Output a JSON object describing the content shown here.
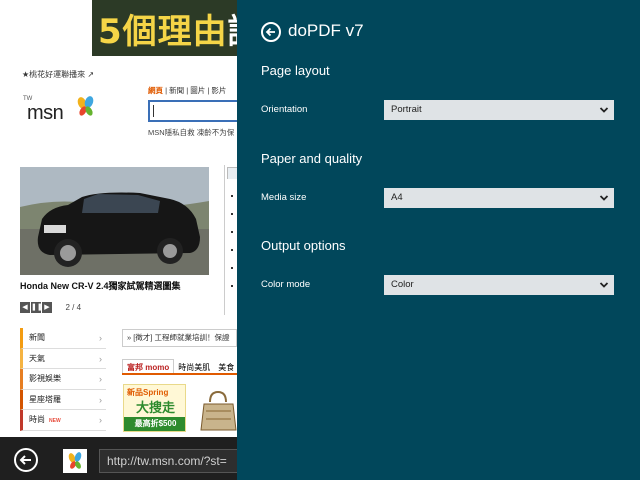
{
  "browser": {
    "ad_banner_text": "5個理由",
    "ad_banner_last_char": "讓",
    "favorites_link": "★桃花好運聯播來 ↗",
    "msn_tw": "TW",
    "msn_word": "msn",
    "search_tabs": [
      {
        "label": "網頁"
      },
      {
        "label": "新聞"
      },
      {
        "label": "圖片"
      },
      {
        "label": "影片"
      }
    ],
    "search_hint": "MSN隱私自救  凍齡不为保",
    "car_caption": "Honda New CR-V 2.4獨家試駕精選圖集",
    "slide_counter": "2 / 4",
    "categories": [
      {
        "label": "新聞"
      },
      {
        "label": "天氣"
      },
      {
        "label": "影視娛樂"
      },
      {
        "label": "星座塔羅"
      },
      {
        "label": "時尚",
        "badge": "NEW"
      }
    ],
    "news_ticker": "» [徵才] 工程師就業培訓！保證",
    "shop_tabs": [
      {
        "label": "富邦 momo"
      },
      {
        "label": "時尚美肌"
      },
      {
        "label": "美食"
      }
    ],
    "shop_ad": {
      "line1": "新品Spring",
      "line2": "大搜走",
      "line3": "最高折$500"
    }
  },
  "appbar": {
    "url": "http://tw.msn.com/?st="
  },
  "panel": {
    "title": "doPDF v7",
    "sections": [
      {
        "title": "Page layout",
        "label": "Orientation",
        "value": "Portrait"
      },
      {
        "title": "Paper and quality",
        "label": "Media size",
        "value": "A4"
      },
      {
        "title": "Output options",
        "label": "Color mode",
        "value": "Color"
      }
    ]
  },
  "colors": {
    "panel_bg": "#01475b",
    "select_bg": "#dfe3e6",
    "appbar_bg": "#1f1f1f",
    "accent_orange": "#e05a00"
  }
}
